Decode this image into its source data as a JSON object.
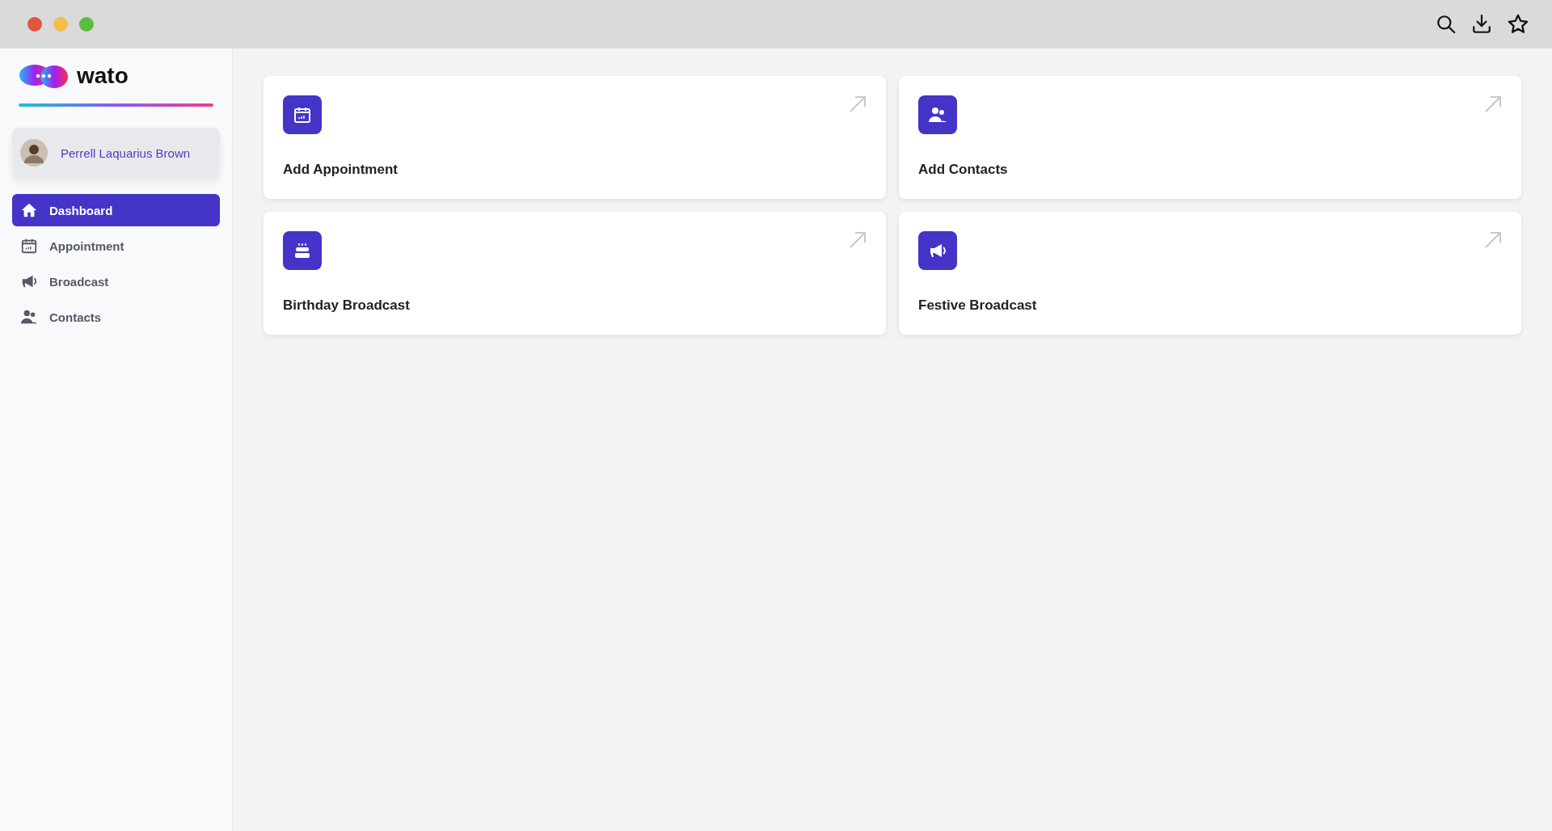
{
  "logo": {
    "text": "wato"
  },
  "user": {
    "name": "Perrell Laquarius Brown"
  },
  "nav": [
    {
      "label": "Dashboard",
      "kind": "home",
      "selected": true
    },
    {
      "label": "Appointment",
      "kind": "calendar",
      "selected": false
    },
    {
      "label": "Broadcast",
      "kind": "megaphone",
      "selected": false
    },
    {
      "label": "Contacts",
      "kind": "users",
      "selected": false
    }
  ],
  "cards": [
    {
      "title": "Add Appointment",
      "kind": "calendar"
    },
    {
      "title": "Add Contacts",
      "kind": "users"
    },
    {
      "title": "Birthday Broadcast",
      "kind": "cake"
    },
    {
      "title": "Festive Broadcast",
      "kind": "megaphone"
    }
  ]
}
